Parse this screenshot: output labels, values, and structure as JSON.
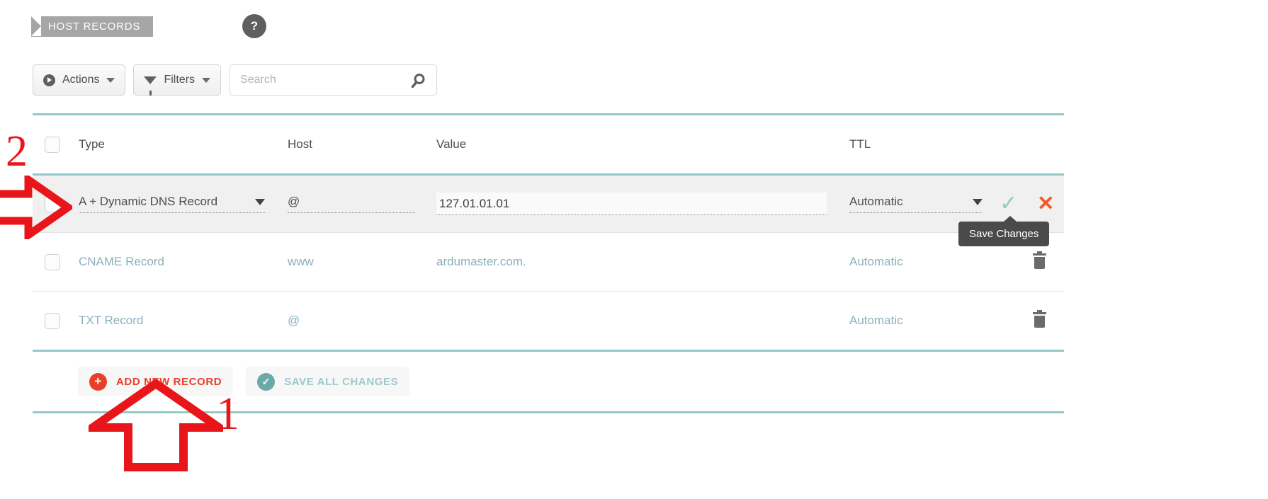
{
  "banner": {
    "label": "HOST RECORDS",
    "help_icon": "question-mark-icon",
    "help_label": "?"
  },
  "toolbar": {
    "actions_label": "Actions",
    "filters_label": "Filters",
    "actions_icon": "play-circle-icon",
    "filters_icon": "funnel-icon",
    "search_placeholder": "Search",
    "search_value": "",
    "search_icon": "magnifier-icon"
  },
  "table": {
    "columns": {
      "type": "Type",
      "host": "Host",
      "value": "Value",
      "ttl": "TTL"
    },
    "edit_row": {
      "type": "A + Dynamic DNS Record",
      "host": "@",
      "value": "127.01.01.01",
      "ttl": "Automatic",
      "save_icon": "checkmark-icon",
      "cancel_icon": "cross-icon"
    },
    "rows": [
      {
        "type": "CNAME Record",
        "host": "www",
        "value": "ardumaster.com.",
        "ttl": "Automatic",
        "redacted": false,
        "delete_icon": "trash-icon"
      },
      {
        "type": "TXT Record",
        "host": "@",
        "value": "",
        "ttl": "Automatic",
        "redacted": true,
        "delete_icon": "trash-icon"
      }
    ]
  },
  "footer": {
    "add_new_record": "ADD NEW RECORD",
    "save_all_changes": "SAVE ALL CHANGES",
    "add_icon": "plus-circle-icon",
    "save_icon": "check-circle-icon"
  },
  "tooltip": {
    "text": "Save Changes"
  },
  "annotations": {
    "step_one": "1",
    "step_two": "2",
    "arrow_up_icon": "red-arrow-up",
    "arrow_right_icon": "red-arrow-right",
    "color": "#e8161b"
  },
  "colors": {
    "teal_rule": "#93c9c6",
    "accent_red": "#e8402a",
    "row_text": "#8ab0bb",
    "edit_row_bg": "#f0f0f0"
  }
}
